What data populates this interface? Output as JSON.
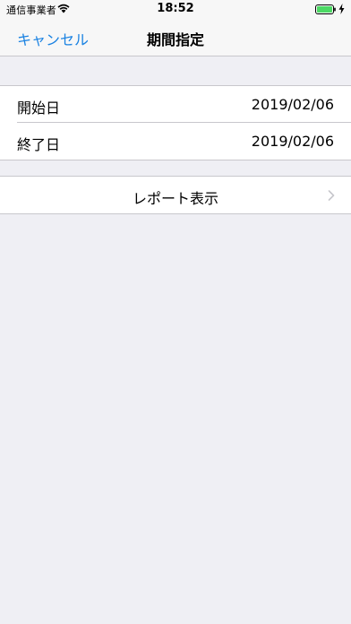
{
  "status_bar": {
    "carrier": "通信事業者",
    "time": "18:52",
    "wifi_icon": "wifi-icon",
    "battery_icon": "battery-icon",
    "charging_icon": "charging-bolt-icon"
  },
  "nav": {
    "cancel_label": "キャンセル",
    "title": "期間指定"
  },
  "dates": [
    {
      "label": "開始日",
      "value": "2019/02/06"
    },
    {
      "label": "終了日",
      "value": "2019/02/06"
    }
  ],
  "report": {
    "label": "レポート表示",
    "chevron_icon": "chevron-right-icon"
  },
  "colors": {
    "accent": "#1A82E2",
    "background": "#EFEFF4",
    "battery": "#4CD964"
  }
}
